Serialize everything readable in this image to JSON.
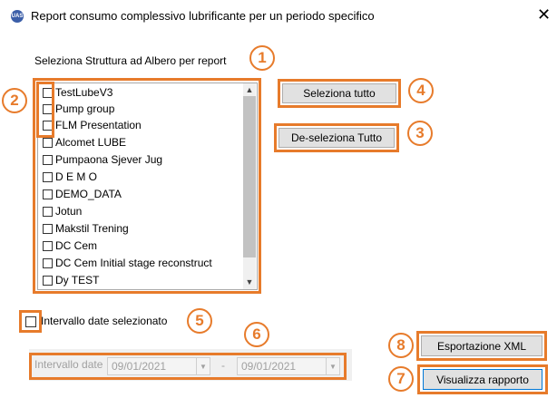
{
  "window": {
    "icon_text": "UAS",
    "title": "Report consumo complessivo lubrificante per un periodo specifico",
    "close_glyph": "✕"
  },
  "tree_label": "Seleziona Struttura ad Albero per report",
  "tree_items": [
    "TestLubeV3",
    "Pump group",
    "FLM Presentation",
    "Alcomet LUBE",
    "Pumpaona Sjever Jug",
    "D E M O",
    "DEMO_DATA",
    "Jotun",
    "Makstil Trening",
    "DC Cem",
    "DC Cem Initial stage reconstruct",
    "Dy TEST"
  ],
  "buttons": {
    "select_all": "Seleziona tutto",
    "deselect_all": "De-seleziona Tutto",
    "export_xml": "Esportazione XML",
    "view_report": "Visualizza rapporto"
  },
  "date_range": {
    "checkbox_label": "Intervallo date selezionato",
    "field_label": "Intervallo date",
    "from": "09/01/2021",
    "separator": "-",
    "to": "09/01/2021"
  },
  "annotations": [
    "1",
    "2",
    "3",
    "4",
    "5",
    "6",
    "7",
    "8"
  ],
  "colors": {
    "accent": "#e77b2b"
  }
}
